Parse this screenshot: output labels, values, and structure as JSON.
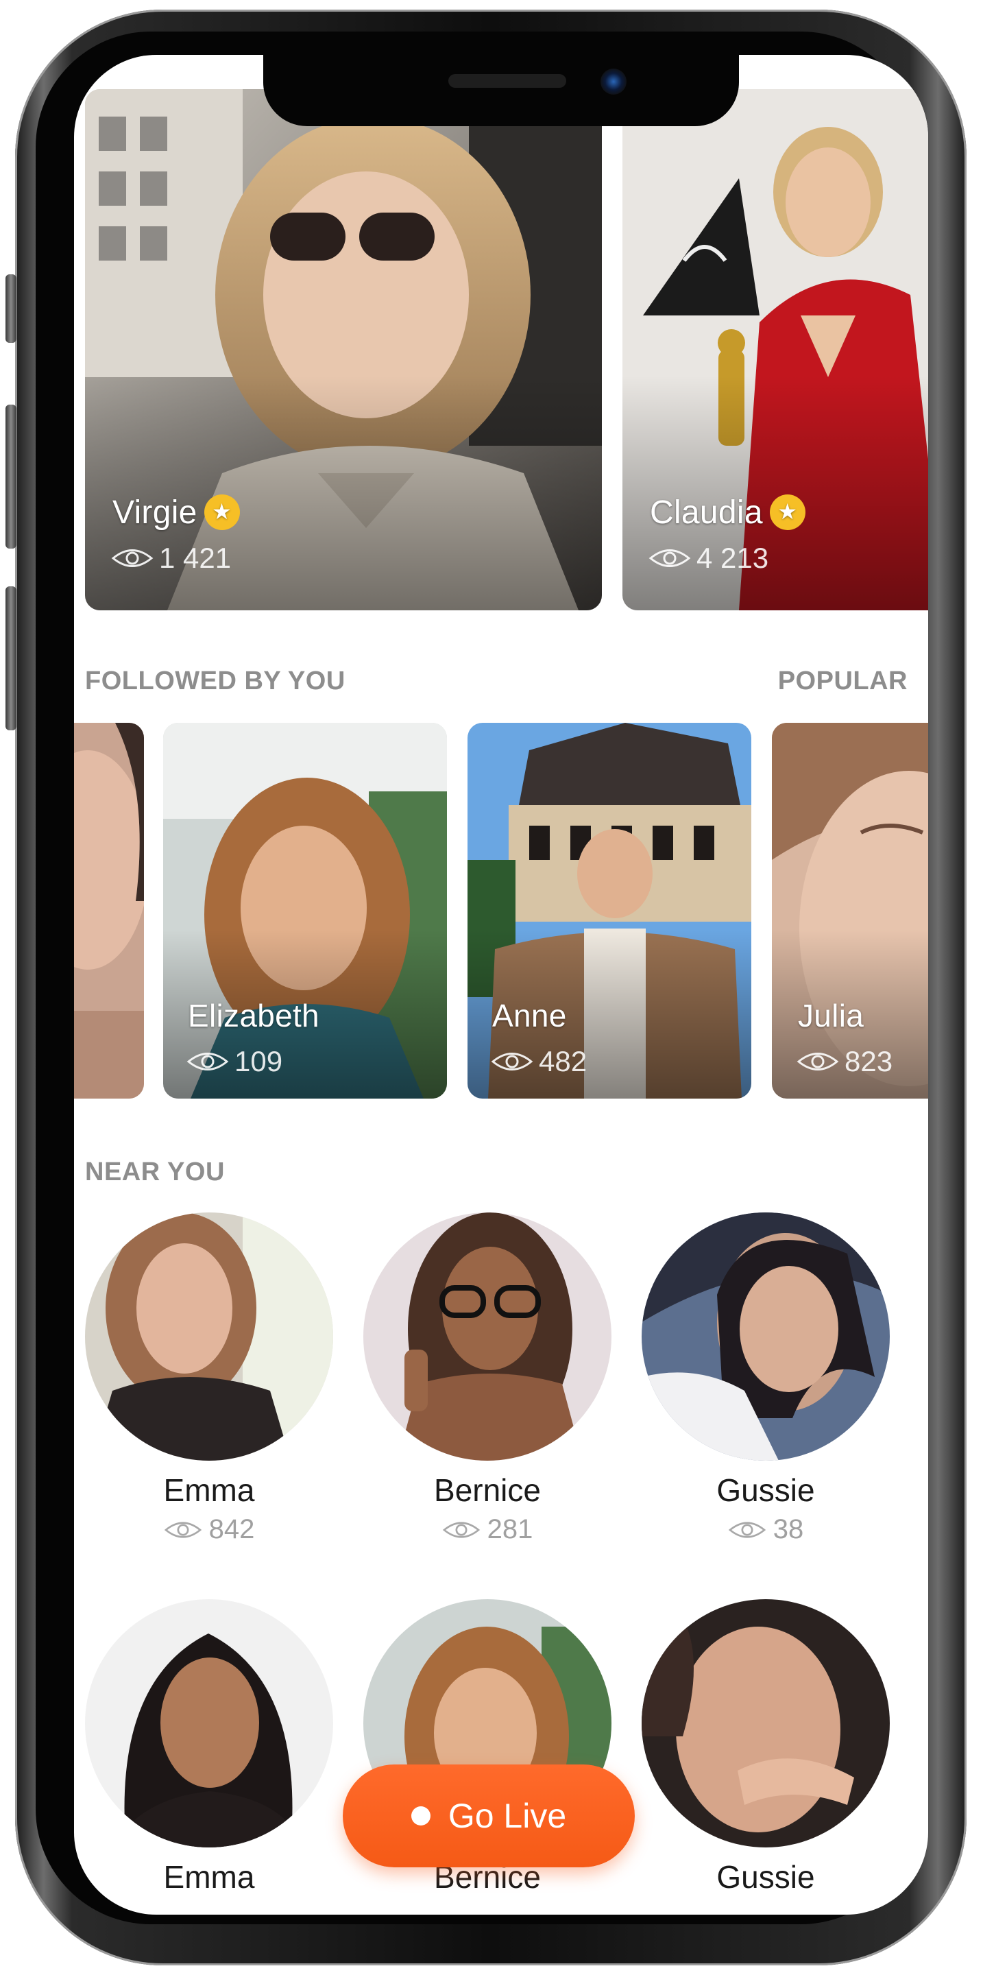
{
  "top_cards": [
    {
      "name": "Virgie",
      "views": "1 421",
      "featured": true
    },
    {
      "name": "Claudia",
      "views": "4 213",
      "featured": true
    }
  ],
  "followed": {
    "title": "FOLLOWED BY YOU",
    "action": "POPULAR",
    "items": [
      {
        "name": "Elizabeth",
        "views": "109"
      },
      {
        "name": "Anne",
        "views": "482"
      },
      {
        "name": "Julia",
        "views": "823"
      }
    ]
  },
  "near_you": {
    "title": "NEAR YOU",
    "people": [
      {
        "name": "Emma",
        "views": "842"
      },
      {
        "name": "Bernice",
        "views": "281"
      },
      {
        "name": "Gussie",
        "views": "38"
      },
      {
        "name": "Emma",
        "views": ""
      },
      {
        "name": "Bernice",
        "views": ""
      },
      {
        "name": "Gussie",
        "views": ""
      }
    ]
  },
  "go_live": {
    "label": "Go Live"
  },
  "colors": {
    "accent": "#f55a16",
    "star": "#f6bf26",
    "section_text": "#8d8d8d"
  },
  "icons": {
    "views": "eye-icon",
    "featured": "star-icon",
    "live": "dot-icon"
  }
}
